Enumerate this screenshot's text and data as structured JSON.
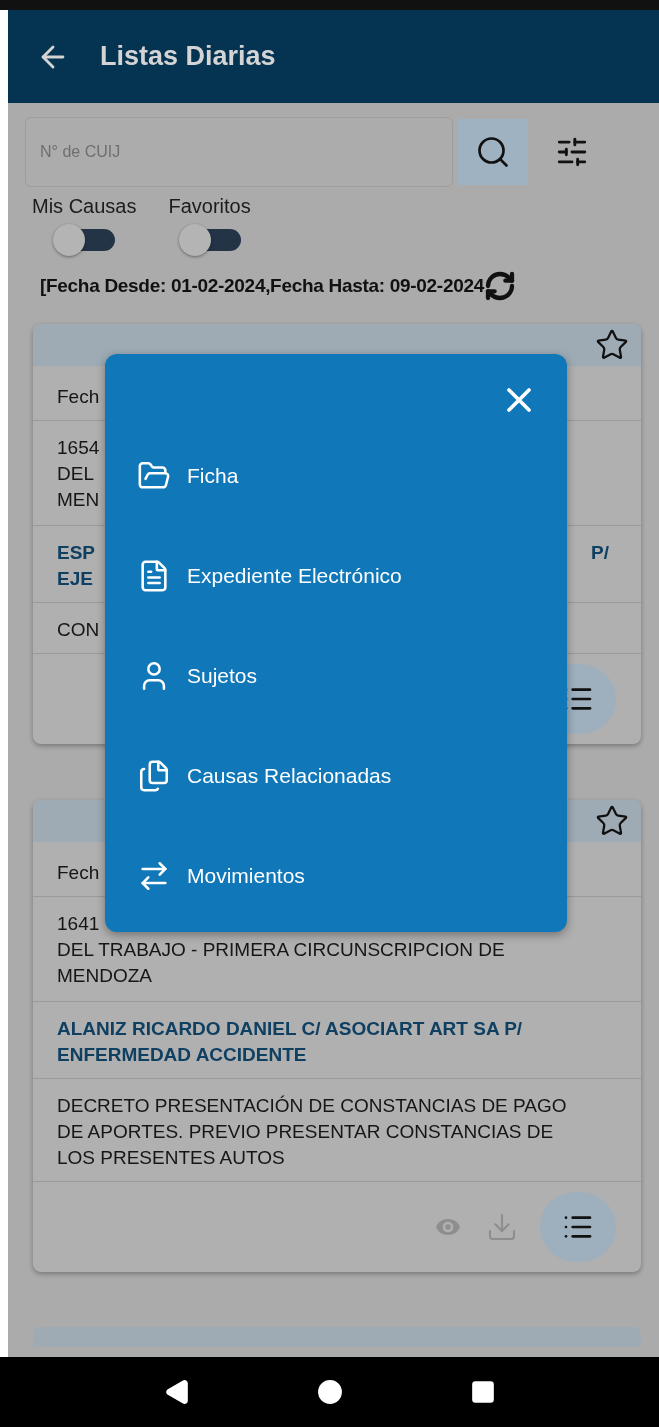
{
  "app_bar": {
    "title": "Listas Diarias"
  },
  "search": {
    "placeholder": "N° de CUIJ"
  },
  "toggles": [
    {
      "label": "Mis Causas",
      "on": false
    },
    {
      "label": "Favoritos",
      "on": false
    }
  ],
  "filter_text": "[Fecha Desde: 01-02-2024,Fecha Hasta: 09-02-2024",
  "cards": [
    {
      "favorite": false,
      "rows": [
        {
          "kind": "date",
          "lines": [
            "Fech"
          ]
        },
        {
          "kind": "court",
          "lines": [
            "1654",
            "DEL",
            "MEN"
          ]
        },
        {
          "kind": "parties",
          "lines": [
            "ESP",
            "EJE"
          ],
          "right": "P/"
        },
        {
          "kind": "description",
          "lines": [
            "CON"
          ]
        }
      ],
      "actions": [
        {
          "kind": "menu"
        }
      ]
    },
    {
      "favorite": false,
      "rows": [
        {
          "kind": "date",
          "lines": [
            "Fech"
          ]
        },
        {
          "kind": "court",
          "lines": [
            "1641",
            "DEL TRABAJO - PRIMERA CIRCUNSCRIPCION DE",
            "MENDOZA"
          ]
        },
        {
          "kind": "parties",
          "lines": [
            "ALANIZ RICARDO DANIEL C/ ASOCIART ART SA P/",
            "ENFERMEDAD ACCIDENTE"
          ]
        },
        {
          "kind": "description",
          "lines": [
            "DECRETO PRESENTACIÓN DE CONSTANCIAS DE PAGO",
            "DE APORTES. PREVIO PRESENTAR CONSTANCIAS DE",
            "LOS PRESENTES AUTOS"
          ]
        }
      ],
      "actions": [
        {
          "kind": "view"
        },
        {
          "kind": "download"
        },
        {
          "kind": "menu"
        }
      ]
    }
  ],
  "menu": {
    "items": [
      {
        "kind": "folder",
        "label": "Ficha"
      },
      {
        "kind": "document",
        "label": "Expediente Electrónico"
      },
      {
        "kind": "person",
        "label": "Sujetos"
      },
      {
        "kind": "documents",
        "label": "Causas Relacionadas"
      },
      {
        "kind": "moves",
        "label": "Movimientos"
      }
    ]
  }
}
